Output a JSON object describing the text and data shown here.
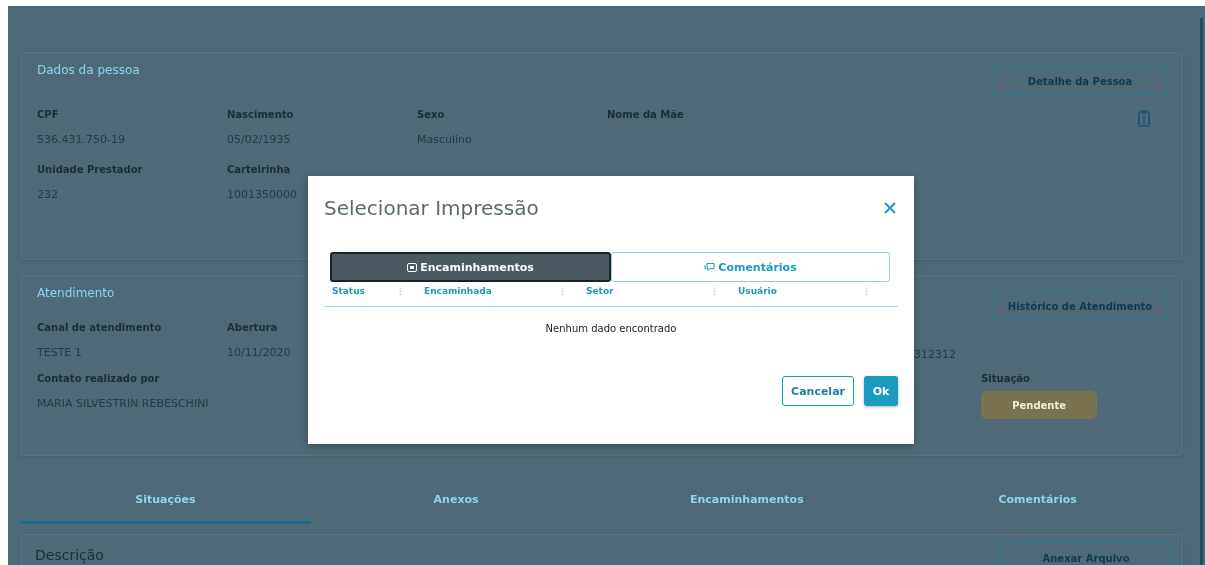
{
  "person": {
    "title": "Dados da pessoa",
    "detail_button": "Detalhe da Pessoa",
    "rows": [
      [
        {
          "label": "CPF",
          "value": "536.431.750-19"
        },
        {
          "label": "Nascimento",
          "value": "05/02/1935"
        },
        {
          "label": "Sexo",
          "value": "Masculino"
        },
        {
          "label": "Nome da Mãe"
        }
      ],
      [
        {
          "label": "Unidade Prestador",
          "value": "232"
        },
        {
          "label": "Carteirinha",
          "value": "1001350000"
        }
      ]
    ]
  },
  "attendance": {
    "title": "Atendimento",
    "history_button": "Histórico de Atendimento",
    "fields": [
      {
        "label": "Canal de atendimento",
        "value": "TESTE 1"
      },
      {
        "label": "Abertura",
        "value": "10/11/2020"
      }
    ],
    "code_value": "312312",
    "contact": {
      "label": "Contato realizado por",
      "value": "MARIA SILVESTRIN REBESCHINI"
    },
    "status": {
      "label": "Situação",
      "value": "Pendente"
    }
  },
  "tabs": [
    {
      "label": "Situações",
      "selected": true
    },
    {
      "label": "Anexos",
      "selected": false
    },
    {
      "label": "Encaminhamentos",
      "selected": false
    },
    {
      "label": "Comentários",
      "selected": false
    }
  ],
  "description": {
    "title": "Descrição",
    "attach_button": "Anexar Arquivo"
  },
  "modal": {
    "title": "Selecionar Impressão",
    "tabs": [
      {
        "label": "Encaminhamentos",
        "selected": true
      },
      {
        "label": "Comentários",
        "selected": false
      }
    ],
    "columns": [
      "Status",
      "Encaminhada",
      "Setor",
      "Usuário"
    ],
    "empty_text": "Nenhum dado encontrado",
    "buttons": {
      "cancel": "Cancelar",
      "ok": "Ok"
    }
  }
}
